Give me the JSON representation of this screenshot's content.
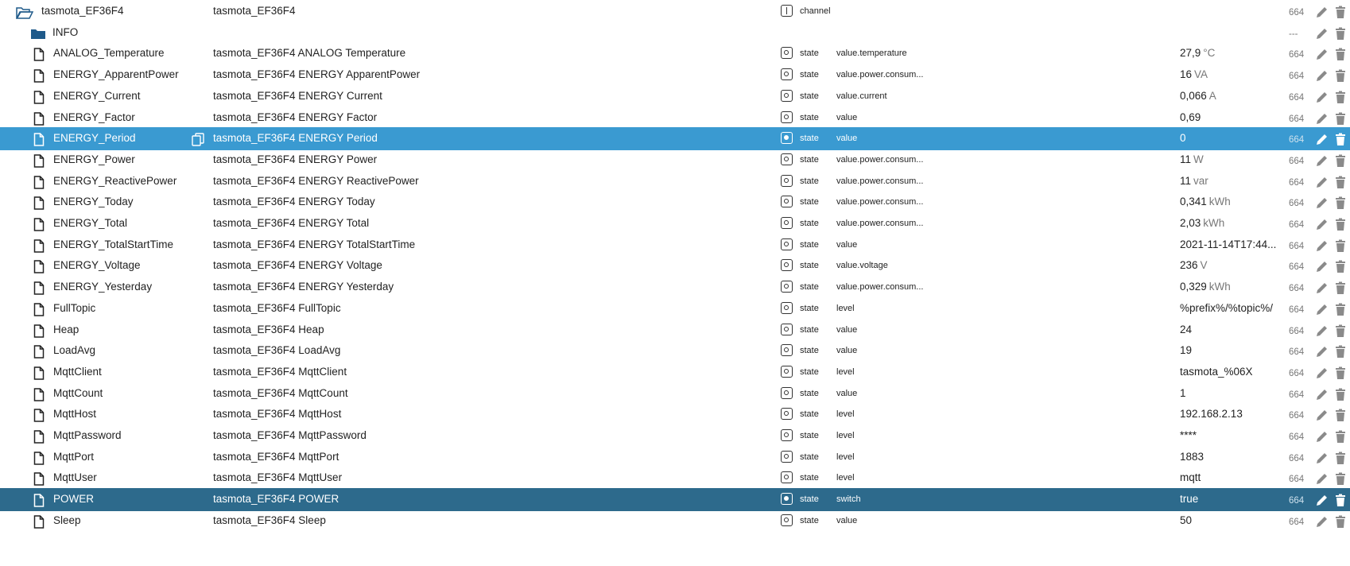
{
  "rows": [
    {
      "name": "tasmota_EF36F4",
      "desc": "tasmota_EF36F4",
      "type": "channel",
      "role": "",
      "value": "",
      "unit": "",
      "acl": "664",
      "icon": "folder-open-icon",
      "indent": 0,
      "state": "normal"
    },
    {
      "name": "INFO",
      "desc": "",
      "type": "",
      "role": "",
      "value": "",
      "unit": "",
      "acl": "---",
      "icon": "folder-icon",
      "indent": 1,
      "state": "normal"
    },
    {
      "name": "ANALOG_Temperature",
      "desc": "tasmota_EF36F4 ANALOG Temperature",
      "type": "state",
      "role": "value.temperature",
      "value": "27,9",
      "unit": "°C",
      "acl": "664",
      "icon": "file-icon",
      "indent": 2,
      "state": "normal"
    },
    {
      "name": "ENERGY_ApparentPower",
      "desc": "tasmota_EF36F4 ENERGY ApparentPower",
      "type": "state",
      "role": "value.power.consum...",
      "value": "16",
      "unit": "VA",
      "acl": "664",
      "icon": "file-icon",
      "indent": 2,
      "state": "normal"
    },
    {
      "name": "ENERGY_Current",
      "desc": "tasmota_EF36F4 ENERGY Current",
      "type": "state",
      "role": "value.current",
      "value": "0,066",
      "unit": "A",
      "acl": "664",
      "icon": "file-icon",
      "indent": 2,
      "state": "normal"
    },
    {
      "name": "ENERGY_Factor",
      "desc": "tasmota_EF36F4 ENERGY Factor",
      "type": "state",
      "role": "value",
      "value": "0,69",
      "unit": "",
      "acl": "664",
      "icon": "file-icon",
      "indent": 2,
      "state": "normal"
    },
    {
      "name": "ENERGY_Period",
      "desc": "tasmota_EF36F4 ENERGY Period",
      "type": "state",
      "role": "value",
      "value": "0",
      "unit": "",
      "acl": "664",
      "icon": "file-icon",
      "indent": 2,
      "state": "selected"
    },
    {
      "name": "ENERGY_Power",
      "desc": "tasmota_EF36F4 ENERGY Power",
      "type": "state",
      "role": "value.power.consum...",
      "value": "11",
      "unit": "W",
      "acl": "664",
      "icon": "file-icon",
      "indent": 2,
      "state": "normal"
    },
    {
      "name": "ENERGY_ReactivePower",
      "desc": "tasmota_EF36F4 ENERGY ReactivePower",
      "type": "state",
      "role": "value.power.consum...",
      "value": "11",
      "unit": "var",
      "acl": "664",
      "icon": "file-icon",
      "indent": 2,
      "state": "normal"
    },
    {
      "name": "ENERGY_Today",
      "desc": "tasmota_EF36F4 ENERGY Today",
      "type": "state",
      "role": "value.power.consum...",
      "value": "0,341",
      "unit": "kWh",
      "acl": "664",
      "icon": "file-icon",
      "indent": 2,
      "state": "normal"
    },
    {
      "name": "ENERGY_Total",
      "desc": "tasmota_EF36F4 ENERGY Total",
      "type": "state",
      "role": "value.power.consum...",
      "value": "2,03",
      "unit": "kWh",
      "acl": "664",
      "icon": "file-icon",
      "indent": 2,
      "state": "normal"
    },
    {
      "name": "ENERGY_TotalStartTime",
      "desc": "tasmota_EF36F4 ENERGY TotalStartTime",
      "type": "state",
      "role": "value",
      "value": "2021-11-14T17:44...",
      "unit": "",
      "acl": "664",
      "icon": "file-icon",
      "indent": 2,
      "state": "normal"
    },
    {
      "name": "ENERGY_Voltage",
      "desc": "tasmota_EF36F4 ENERGY Voltage",
      "type": "state",
      "role": "value.voltage",
      "value": "236",
      "unit": "V",
      "acl": "664",
      "icon": "file-icon",
      "indent": 2,
      "state": "normal"
    },
    {
      "name": "ENERGY_Yesterday",
      "desc": "tasmota_EF36F4 ENERGY Yesterday",
      "type": "state",
      "role": "value.power.consum...",
      "value": "0,329",
      "unit": "kWh",
      "acl": "664",
      "icon": "file-icon",
      "indent": 2,
      "state": "normal"
    },
    {
      "name": "FullTopic",
      "desc": "tasmota_EF36F4 FullTopic",
      "type": "state",
      "role": "level",
      "value": "%prefix%/%topic%/",
      "unit": "",
      "acl": "664",
      "icon": "file-icon",
      "indent": 2,
      "state": "normal"
    },
    {
      "name": "Heap",
      "desc": "tasmota_EF36F4 Heap",
      "type": "state",
      "role": "value",
      "value": "24",
      "unit": "",
      "acl": "664",
      "icon": "file-icon",
      "indent": 2,
      "state": "normal"
    },
    {
      "name": "LoadAvg",
      "desc": "tasmota_EF36F4 LoadAvg",
      "type": "state",
      "role": "value",
      "value": "19",
      "unit": "",
      "acl": "664",
      "icon": "file-icon",
      "indent": 2,
      "state": "normal"
    },
    {
      "name": "MqttClient",
      "desc": "tasmota_EF36F4 MqttClient",
      "type": "state",
      "role": "level",
      "value": "tasmota_%06X",
      "unit": "",
      "acl": "664",
      "icon": "file-icon",
      "indent": 2,
      "state": "normal"
    },
    {
      "name": "MqttCount",
      "desc": "tasmota_EF36F4 MqttCount",
      "type": "state",
      "role": "value",
      "value": "1",
      "unit": "",
      "acl": "664",
      "icon": "file-icon",
      "indent": 2,
      "state": "normal"
    },
    {
      "name": "MqttHost",
      "desc": "tasmota_EF36F4 MqttHost",
      "type": "state",
      "role": "level",
      "value": "192.168.2.13",
      "unit": "",
      "acl": "664",
      "icon": "file-icon",
      "indent": 2,
      "state": "normal"
    },
    {
      "name": "MqttPassword",
      "desc": "tasmota_EF36F4 MqttPassword",
      "type": "state",
      "role": "level",
      "value": "****",
      "unit": "",
      "acl": "664",
      "icon": "file-icon",
      "indent": 2,
      "state": "normal"
    },
    {
      "name": "MqttPort",
      "desc": "tasmota_EF36F4 MqttPort",
      "type": "state",
      "role": "level",
      "value": "1883",
      "unit": "",
      "acl": "664",
      "icon": "file-icon",
      "indent": 2,
      "state": "normal"
    },
    {
      "name": "MqttUser",
      "desc": "tasmota_EF36F4 MqttUser",
      "type": "state",
      "role": "level",
      "value": "mqtt",
      "unit": "",
      "acl": "664",
      "icon": "file-icon",
      "indent": 2,
      "state": "normal"
    },
    {
      "name": "POWER",
      "desc": "tasmota_EF36F4 POWER",
      "type": "state",
      "role": "switch",
      "value": "true",
      "unit": "",
      "acl": "664",
      "icon": "file-icon",
      "indent": 2,
      "state": "highlight"
    },
    {
      "name": "Sleep",
      "desc": "tasmota_EF36F4 Sleep",
      "type": "state",
      "role": "value",
      "value": "50",
      "unit": "",
      "acl": "664",
      "icon": "file-icon",
      "indent": 2,
      "state": "normal"
    }
  ],
  "colors": {
    "selected": "#3a9ad1",
    "highlight": "#2d6a8c",
    "folder": "#1f5a8a"
  }
}
